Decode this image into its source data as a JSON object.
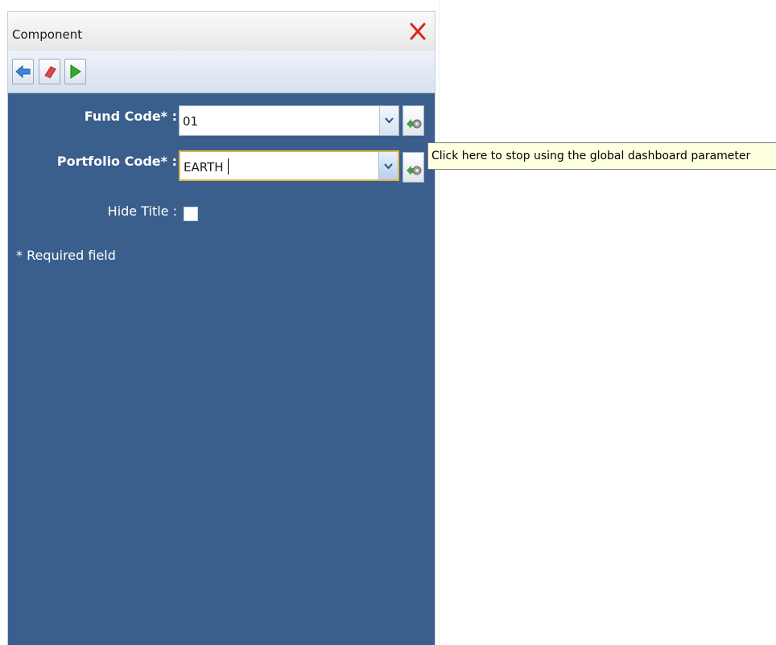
{
  "window": {
    "title": "Component"
  },
  "toolbar": {
    "buttons": [
      {
        "icon": "back-arrow-icon",
        "color": "#3a86d8"
      },
      {
        "icon": "eraser-icon",
        "color": "#e04848"
      },
      {
        "icon": "play-icon",
        "color": "#2eae2e"
      }
    ]
  },
  "form": {
    "fund_code": {
      "label": "Fund Code* :",
      "value": "01"
    },
    "portfolio_code": {
      "label": "Portfolio Code* :",
      "value": "EARTH"
    },
    "hide_title": {
      "label": "Hide Title :",
      "checked": false
    },
    "required_note": "* Required field"
  },
  "tooltip": {
    "text": "Click here to stop using the global dashboard parameter"
  },
  "colors": {
    "panel_background": "#3b5f8c",
    "close_icon": "#d9251c",
    "focus_border": "#e3b54a",
    "tooltip_background": "#ffffe1"
  }
}
